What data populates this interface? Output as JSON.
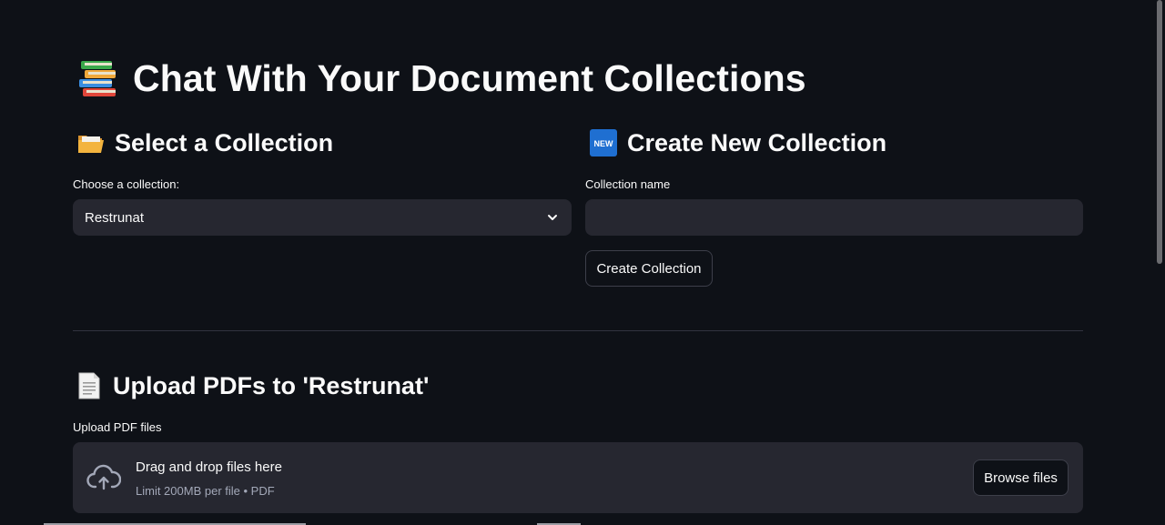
{
  "title": "Chat With Your Document Collections",
  "select_section": {
    "heading": "Select a Collection",
    "label": "Choose a collection:",
    "selected": "Restrunat"
  },
  "create_section": {
    "heading": "Create New Collection",
    "label": "Collection name",
    "input_value": "",
    "button_label": "Create Collection"
  },
  "upload_section": {
    "heading": "Upload PDFs to 'Restrunat'",
    "label": "Upload PDF files",
    "drop_text": "Drag and drop files here",
    "limit_text": "Limit 200MB per file • PDF",
    "browse_label": "Browse files"
  },
  "icons": {
    "title": "books-icon",
    "select": "folder-icon",
    "create": "new-badge-icon",
    "upload": "page-icon",
    "dropzone": "cloud-upload-icon",
    "select_caret": "chevron-down-icon"
  },
  "colors": {
    "background": "#0e1117",
    "widget": "#262730",
    "text": "#fafafa",
    "muted": "#a3a8b8",
    "new_badge": "#1f6fd1"
  }
}
